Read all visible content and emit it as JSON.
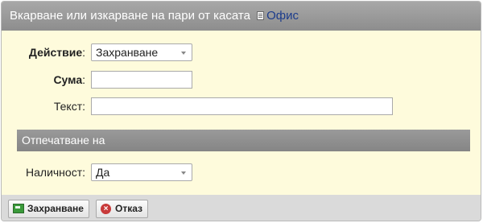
{
  "dialog": {
    "title": "Вкарване или изкарване на пари от касата",
    "title_link": "Офис"
  },
  "form": {
    "action": {
      "label": "Действие",
      "value": "Захранване"
    },
    "amount": {
      "label": "Сума",
      "value": ""
    },
    "text": {
      "label": "Текст",
      "value": ""
    }
  },
  "print_section": {
    "title": "Отпечатване на",
    "availability": {
      "label": "Наличност",
      "value": "Да"
    }
  },
  "buttons": {
    "save": "Захранване",
    "cancel": "Отказ"
  }
}
